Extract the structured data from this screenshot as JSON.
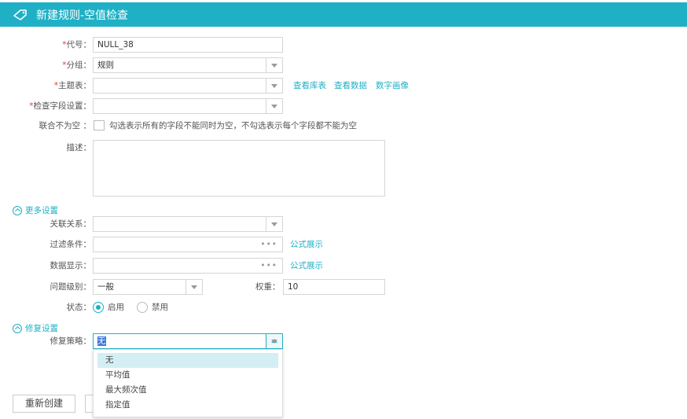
{
  "header": {
    "title": "新建规则-空值检查",
    "icon": "tag-icon"
  },
  "form": {
    "code": {
      "label": "代号",
      "value": "NULL_38"
    },
    "group": {
      "label": "分组",
      "value": "规则"
    },
    "subject_table": {
      "label": "主题表",
      "value": "",
      "links": [
        "查看库表",
        "查看数据",
        "数字画像"
      ]
    },
    "check_field": {
      "label": "检查字段设置",
      "value": ""
    },
    "joint_not_null": {
      "label": "联合不为空",
      "checked": false,
      "hint": "勾选表示所有的字段不能同时为空，不勾选表示每个字段都不能为空"
    },
    "description": {
      "label": "描述",
      "value": ""
    }
  },
  "more_settings": {
    "title": "更多设置",
    "relation": {
      "label": "关联关系",
      "value": ""
    },
    "filter": {
      "label": "过滤条件",
      "value": "",
      "link": "公式展示"
    },
    "data_display": {
      "label": "数据显示",
      "value": "",
      "link": "公式展示"
    },
    "level": {
      "label": "问题级别",
      "value": "一般"
    },
    "weight": {
      "label": "权重",
      "value": "10"
    },
    "status": {
      "label": "状态",
      "options": [
        "启用",
        "禁用"
      ],
      "selected": "启用"
    }
  },
  "repair": {
    "title": "修复设置",
    "strategy": {
      "label": "修复策略",
      "value": "无",
      "options": [
        "无",
        "平均值",
        "最大频次值",
        "指定值"
      ],
      "highlighted": "无"
    }
  },
  "buttons": {
    "recreate": "重新创建"
  },
  "colors": {
    "accent": "#1fb0c6",
    "required": "#e4393c"
  }
}
